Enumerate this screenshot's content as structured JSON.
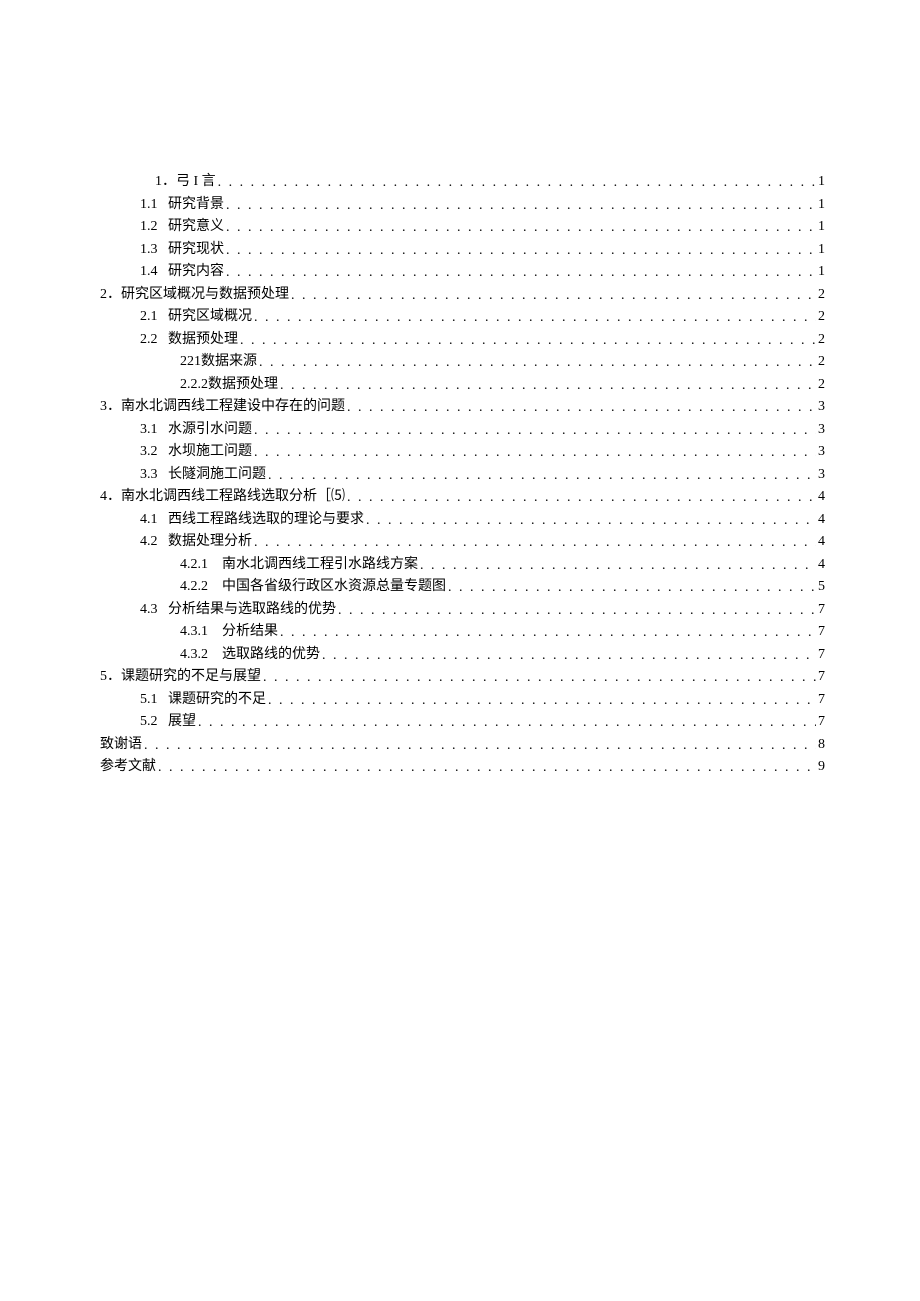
{
  "toc": {
    "e1": {
      "num": "1",
      "title": "．弓 I 言",
      "page": "1"
    },
    "e2": {
      "num": "1.1",
      "title": "研究背景",
      "page": "1"
    },
    "e3": {
      "num": "1.2",
      "title": "研究意义",
      "page": "1"
    },
    "e4": {
      "num": "1.3",
      "title": "研究现状",
      "page": "1"
    },
    "e5": {
      "num": "1.4",
      "title": "研究内容",
      "page": "1"
    },
    "e6": {
      "num": "2",
      "title": "．研究区域概况与数据预处理",
      "page": "2"
    },
    "e7": {
      "num": "2.1",
      "title": "研究区域概况",
      "page": "2"
    },
    "e8": {
      "num": "2.2",
      "title": "数据预处理",
      "page": "2"
    },
    "e9": {
      "num": "221",
      "title": "数据来源",
      "page": "2"
    },
    "e10": {
      "num": "2.2.2",
      "title": "数据预处理",
      "page": "2"
    },
    "e11": {
      "num": "3",
      "title": "．南水北调西线工程建设中存在的问题",
      "page": "3"
    },
    "e12": {
      "num": "3.1",
      "title": "水源引水问题",
      "page": "3"
    },
    "e13": {
      "num": "3.2",
      "title": "水坝施工问题",
      "page": "3"
    },
    "e14": {
      "num": "3.3",
      "title": "长隧洞施工问题",
      "page": "3"
    },
    "e15": {
      "num": "4",
      "title": "．南水北调西线工程路线选取分析［⑸",
      "page": "4"
    },
    "e16": {
      "num": "4.1",
      "title": "西线工程路线选取的理论与要求",
      "page": "4"
    },
    "e17": {
      "num": "4.2",
      "title": "数据处理分析",
      "page": "4"
    },
    "e18": {
      "num": "4.2.1",
      "title": "南水北调西线工程引水路线方案",
      "page": "4"
    },
    "e19": {
      "num": "4.2.2",
      "title": "中国各省级行政区水资源总量专题图",
      "page": "5"
    },
    "e20": {
      "num": "4.3",
      "title": "分析结果与选取路线的优势",
      "page": "7"
    },
    "e21": {
      "num": "4.3.1",
      "title": "分析结果",
      "page": "7"
    },
    "e22": {
      "num": "4.3.2",
      "title": "选取路线的优势",
      "page": "7"
    },
    "e23": {
      "num": "5",
      "title": "．课题研究的不足与展望",
      "page": "7"
    },
    "e24": {
      "num": "5.1",
      "title": "课题研究的不足",
      "page": "7"
    },
    "e25": {
      "num": "5.2",
      "title": "展望",
      "page": "7"
    },
    "e26": {
      "title": "致谢语",
      "page": "8"
    },
    "e27": {
      "title": "参考文献",
      "page": "9"
    }
  }
}
